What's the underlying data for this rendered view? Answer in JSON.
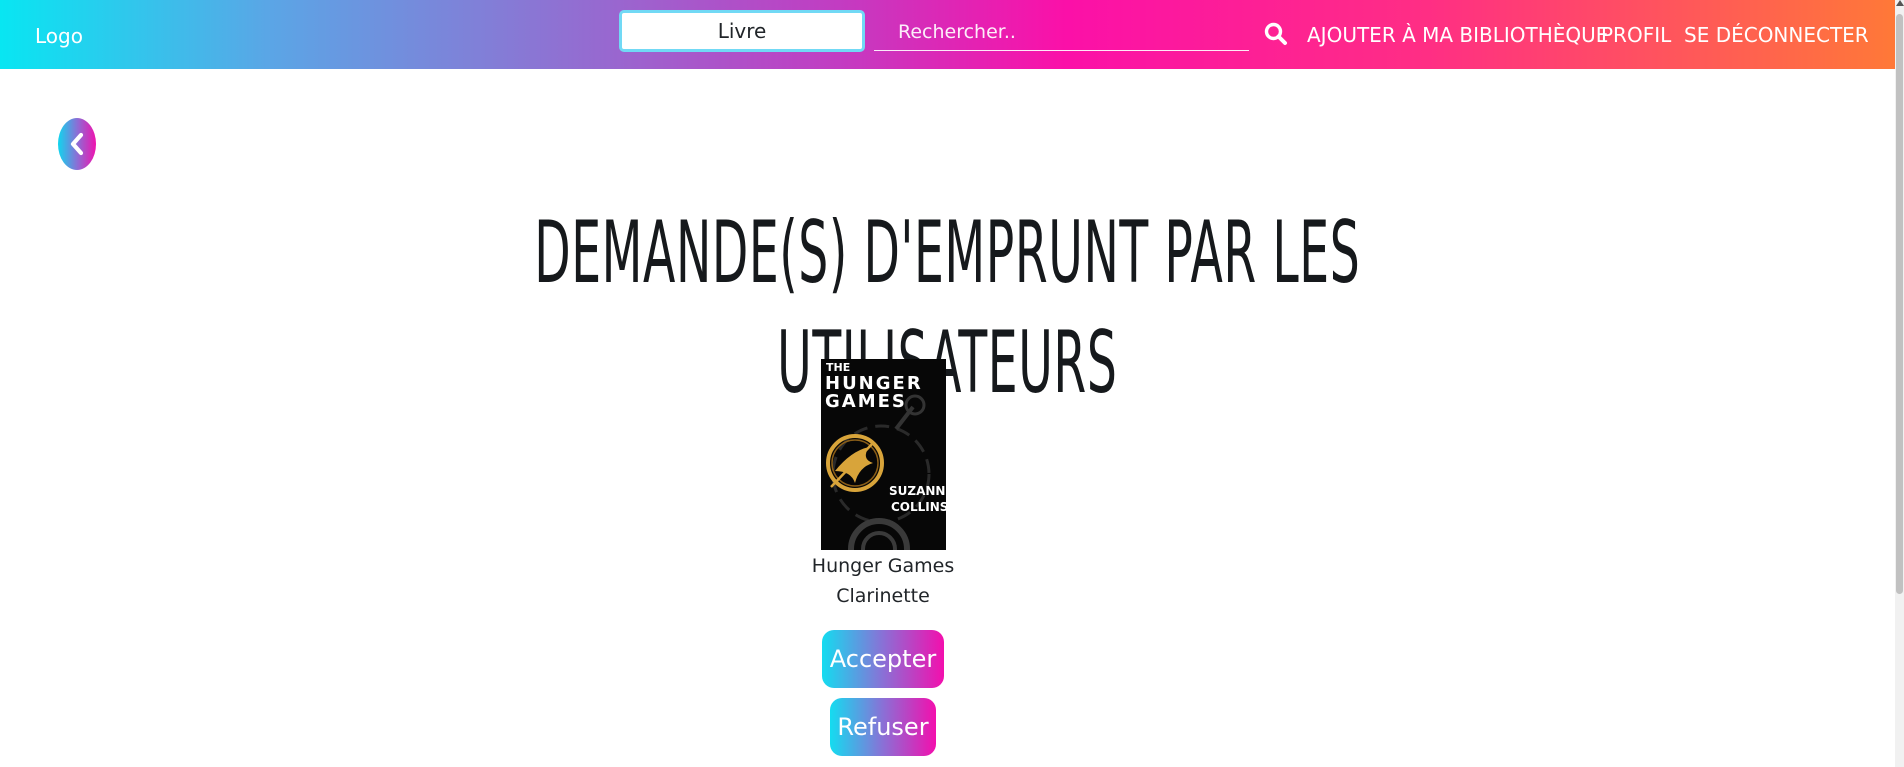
{
  "header": {
    "logo": "Logo",
    "type_select": "Livre",
    "search_placeholder": "Rechercher..",
    "search_icon": "search-icon",
    "nav": {
      "add": "AJOUTER À MA BIBLIOTHÈQUE",
      "profile": "PROFIL",
      "logout": "SE DÉCONNECTER"
    }
  },
  "back_icon": "chevron-left-icon",
  "page_title": "Demande(s) d'emprunt par les utilisateurs",
  "request": {
    "cover_text": {
      "title_line1": "THE",
      "title_line2": "HUNGER",
      "title_line3": "GAMES",
      "author_line1": "SUZANNE",
      "author_line2": "COLLINS"
    },
    "book_title": "Hunger Games",
    "user": "Clarinette",
    "accept": "Accepter",
    "refuse": "Refuser"
  },
  "colors": {
    "gradient_start": "#08e6f2",
    "gradient_mid": "#fb10a8",
    "gradient_end": "#ff7a36"
  }
}
